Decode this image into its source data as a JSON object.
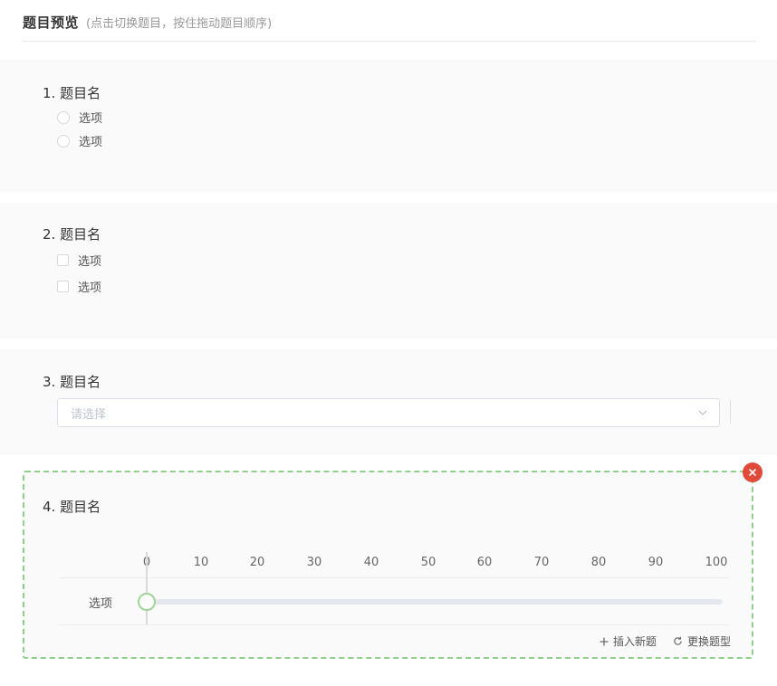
{
  "header": {
    "title": "题目预览",
    "hint": "(点击切换题目，按住拖动题目顺序)"
  },
  "questions": [
    {
      "number": "1.",
      "title": "题目名",
      "type": "radio",
      "options": [
        "选项",
        "选项"
      ]
    },
    {
      "number": "2.",
      "title": "题目名",
      "type": "checkbox",
      "options": [
        "选项",
        "选项"
      ]
    },
    {
      "number": "3.",
      "title": "题目名",
      "type": "select",
      "placeholder": "请选择"
    },
    {
      "number": "4.",
      "title": "题目名",
      "type": "slider",
      "row_label": "选项",
      "ticks": [
        "0",
        "10",
        "20",
        "30",
        "40",
        "50",
        "60",
        "70",
        "80",
        "90",
        "100"
      ],
      "value": 0
    }
  ],
  "actions": {
    "insert_label": "插入新题",
    "change_type_label": "更换题型"
  },
  "colors": {
    "accent_green": "#8fd08a",
    "close_red": "#e04a3a"
  },
  "icons": {
    "close": "close-icon",
    "chevron": "chevron-down-icon",
    "insert": "plus-icon",
    "change": "refresh-icon"
  }
}
